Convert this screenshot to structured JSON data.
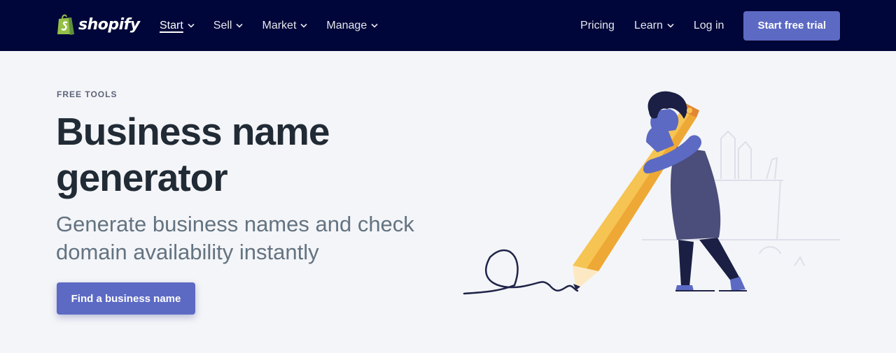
{
  "nav": {
    "logo_text": "shopify",
    "left_items": [
      {
        "label": "Start",
        "active": true
      },
      {
        "label": "Sell"
      },
      {
        "label": "Market"
      },
      {
        "label": "Manage"
      }
    ],
    "pricing": "Pricing",
    "learn": "Learn",
    "login": "Log in",
    "cta": "Start free trial"
  },
  "hero": {
    "eyebrow": "FREE TOOLS",
    "headline": "Business name generator",
    "subheadline": "Generate business names and check domain availability instantly",
    "cta": "Find a business name"
  },
  "colors": {
    "nav_bg": "#000639",
    "accent": "#5c6ac4",
    "page_bg": "#f4f5f8",
    "headline": "#212b36",
    "subhead": "#637381",
    "pencil": "#f6c453",
    "figure": "#4b4d7a"
  },
  "icons": {
    "logo": "shopify-bag-icon",
    "dropdown": "chevron-down-icon"
  }
}
